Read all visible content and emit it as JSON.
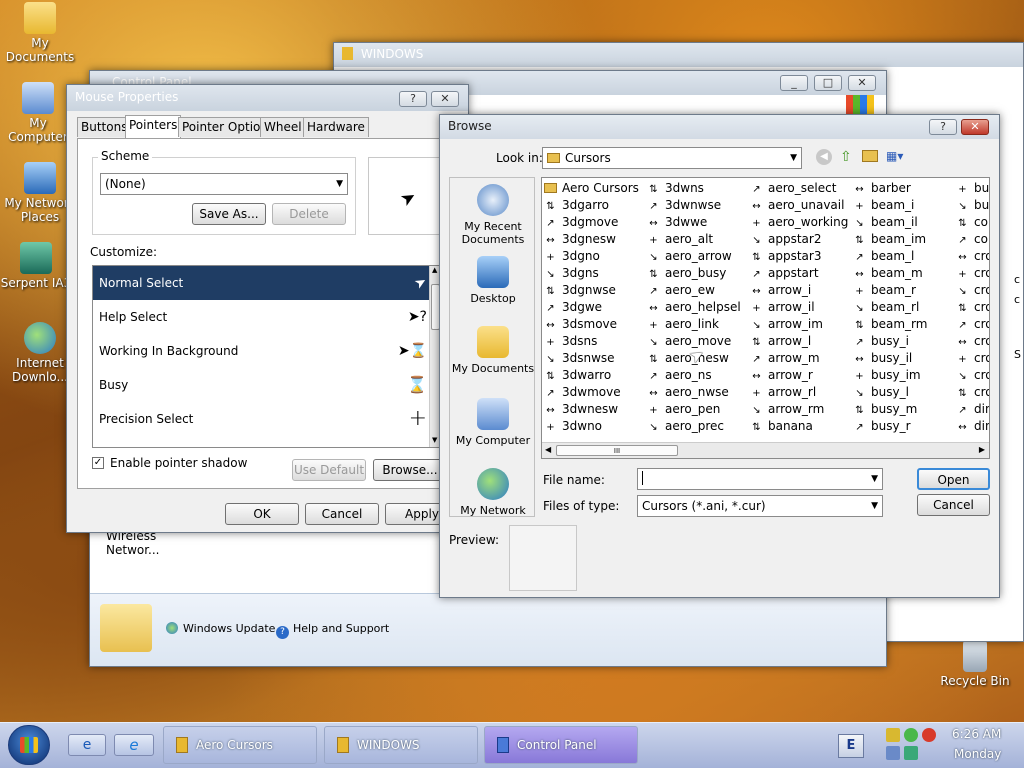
{
  "desktop": {
    "icons": [
      {
        "label": "My Documents"
      },
      {
        "label": "My Computer"
      },
      {
        "label": "My Network Places"
      },
      {
        "label": "Serpent IA3"
      },
      {
        "label": "Internet Downlo..."
      },
      {
        "label": "Recycle Bin"
      }
    ]
  },
  "windows_bg": {
    "title": "WINDOWS"
  },
  "control_panel": {
    "title": "Control Panel",
    "wireless_label": "Wireless Networ...",
    "windows_update": "Windows Update",
    "help_support": "Help and Support"
  },
  "mouse_props": {
    "title": "Mouse Properties",
    "help_glyph": "?",
    "tabs": [
      "Buttons",
      "Pointers",
      "Pointer Options",
      "Wheel",
      "Hardware"
    ],
    "scheme_label": "Scheme",
    "scheme_value": "(None)",
    "save_as": "Save As...",
    "delete": "Delete",
    "customize_label": "Customize:",
    "cursors": [
      {
        "label": "Normal Select",
        "glyph": "➤"
      },
      {
        "label": "Help Select",
        "glyph": "➤?"
      },
      {
        "label": "Working In Background",
        "glyph": "➤⌛"
      },
      {
        "label": "Busy",
        "glyph": "⌛"
      },
      {
        "label": "Precision Select",
        "glyph": "+"
      }
    ],
    "enable_shadow": "Enable pointer shadow",
    "use_default": "Use Default",
    "browse": "Browse...",
    "ok": "OK",
    "cancel": "Cancel",
    "apply": "Apply"
  },
  "browse": {
    "title": "Browse",
    "help_glyph": "?",
    "look_in_label": "Look in:",
    "look_in_value": "Cursors",
    "places": [
      "My Recent Documents",
      "Desktop",
      "My Documents",
      "My Computer",
      "My Network"
    ],
    "columns": [
      [
        "Aero Cursors",
        "3dgarro",
        "3dgmove",
        "3dgnesw",
        "3dgno",
        "3dgns",
        "3dgnwse",
        "3dgwe",
        "3dsmove",
        "3dsns",
        "3dsnwse",
        "3dwarro",
        "3dwmove",
        "3dwnesw",
        "3dwno"
      ],
      [
        "3dwns",
        "3dwnwse",
        "3dwwe",
        "aero_alt",
        "aero_arrow",
        "aero_busy",
        "aero_ew",
        "aero_helpsel",
        "aero_link",
        "aero_move",
        "aero_nesw",
        "aero_ns",
        "aero_nwse",
        "aero_pen",
        "aero_prec"
      ],
      [
        "aero_select",
        "aero_unavail",
        "aero_working",
        "appstar2",
        "appstar3",
        "appstart",
        "arrow_i",
        "arrow_il",
        "arrow_im",
        "arrow_l",
        "arrow_m",
        "arrow_r",
        "arrow_rl",
        "arrow_rm",
        "banana"
      ],
      [
        "barber",
        "beam_i",
        "beam_il",
        "beam_im",
        "beam_l",
        "beam_m",
        "beam_r",
        "beam_rl",
        "beam_rm",
        "busy_i",
        "busy_il",
        "busy_im",
        "busy_l",
        "busy_m",
        "busy_r"
      ],
      [
        "bu:",
        "bu:",
        "coi",
        "cou",
        "cro",
        "cro",
        "cro",
        "cro",
        "cro",
        "cro",
        "cro",
        "cro",
        "cro",
        "din",
        "din"
      ]
    ],
    "file_name_label": "File name:",
    "file_name_value": "",
    "files_of_type_label": "Files of type:",
    "files_of_type_value": "Cursors (*.ani, *.cur)",
    "open": "Open",
    "cancel": "Cancel",
    "preview_label": "Preview:",
    "scroll_grip": "III"
  },
  "taskbar": {
    "tasks": [
      "Aero Cursors",
      "WINDOWS",
      "Control Panel"
    ],
    "time": "6:26 AM",
    "day": "Monday"
  },
  "colors": {
    "selection": "#1f3d64",
    "taskbar": "#c6d0ea"
  }
}
